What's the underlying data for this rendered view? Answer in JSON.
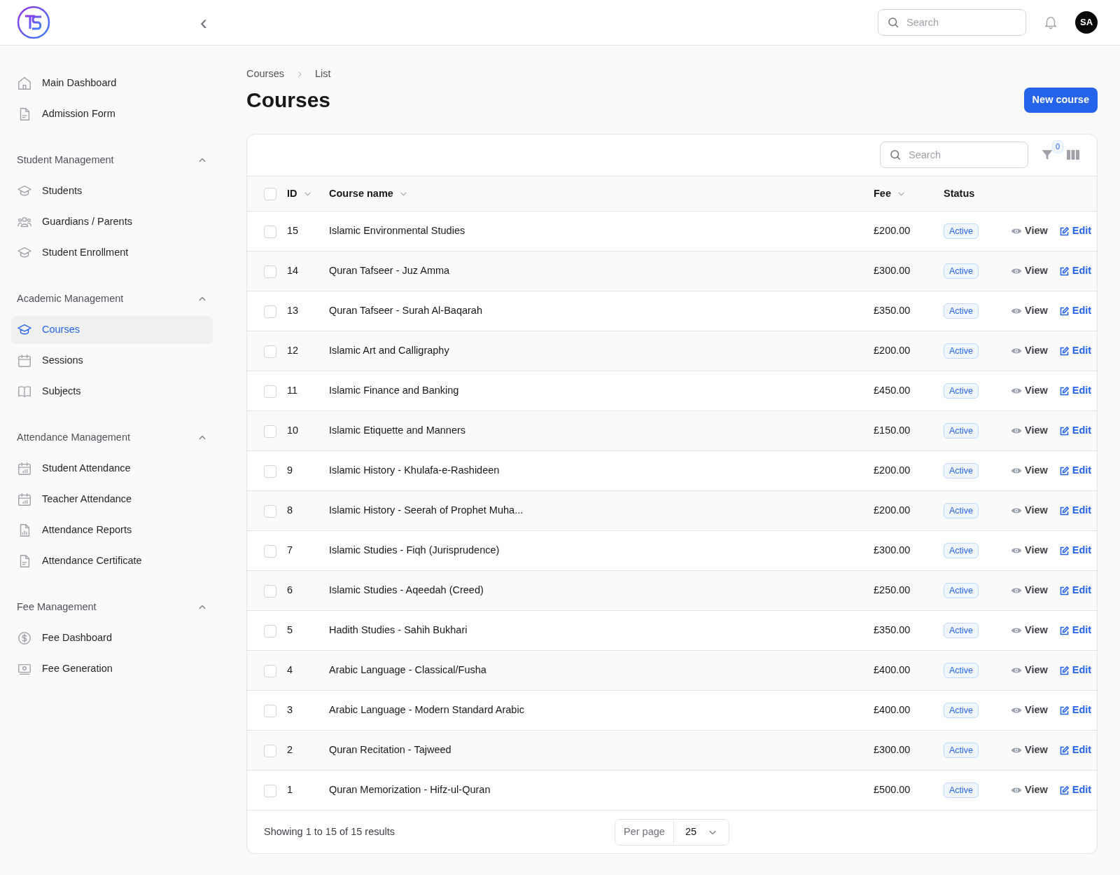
{
  "header": {
    "collapse_label": "‹",
    "search": {
      "placeholder": "Search"
    },
    "avatar": "SA"
  },
  "sidebar": {
    "items": [
      {
        "label": "Main Dashboard",
        "kind": "home",
        "selected": false
      },
      {
        "label": "Admission Form",
        "kind": "doc",
        "selected": false
      }
    ],
    "groups": [
      {
        "title": "Student Management",
        "expanded": true,
        "items": [
          {
            "label": "Students",
            "kind": "cap",
            "selected": false
          },
          {
            "label": "Guardians / Parents",
            "kind": "people",
            "selected": false
          },
          {
            "label": "Student Enrollment",
            "kind": "cap",
            "selected": false
          }
        ]
      },
      {
        "title": "Academic Management",
        "expanded": true,
        "items": [
          {
            "label": "Courses",
            "kind": "cap",
            "selected": true
          },
          {
            "label": "Sessions",
            "kind": "calendar",
            "selected": false
          },
          {
            "label": "Subjects",
            "kind": "book",
            "selected": false
          }
        ]
      },
      {
        "title": "Attendance Management",
        "expanded": true,
        "items": [
          {
            "label": "Student Attendance",
            "kind": "calchart",
            "selected": false
          },
          {
            "label": "Teacher Attendance",
            "kind": "calchart",
            "selected": false
          },
          {
            "label": "Attendance Reports",
            "kind": "docchart",
            "selected": false
          },
          {
            "label": "Attendance Certificate",
            "kind": "doc",
            "selected": false
          }
        ]
      },
      {
        "title": "Fee Management",
        "expanded": true,
        "items": [
          {
            "label": "Fee Dashboard",
            "kind": "dollar",
            "selected": false
          },
          {
            "label": "Fee Generation",
            "kind": "cash",
            "selected": false
          }
        ]
      }
    ]
  },
  "breadcrumb": [
    "Courses",
    "List"
  ],
  "title": "Courses",
  "new_button": "New course",
  "table": {
    "search": {
      "placeholder": "Search"
    },
    "filter_count": "0",
    "all_selected": false,
    "columns": [
      {
        "label": "ID",
        "sortable": true
      },
      {
        "label": "Course name",
        "sortable": true
      },
      {
        "label": "Fee",
        "sortable": true
      },
      {
        "label": "Status",
        "sortable": false
      }
    ],
    "rows": [
      {
        "id": "15",
        "name": "Islamic Environmental Studies",
        "fee": "£200.00",
        "status": "Active",
        "selected": false,
        "actions": [
          "View",
          "Edit"
        ]
      },
      {
        "id": "14",
        "name": "Quran Tafseer - Juz Amma",
        "fee": "£300.00",
        "status": "Active",
        "selected": false,
        "actions": [
          "View",
          "Edit"
        ]
      },
      {
        "id": "13",
        "name": "Quran Tafseer - Surah Al-Baqarah",
        "fee": "£350.00",
        "status": "Active",
        "selected": false,
        "actions": [
          "View",
          "Edit"
        ]
      },
      {
        "id": "12",
        "name": "Islamic Art and Calligraphy",
        "fee": "£200.00",
        "status": "Active",
        "selected": false,
        "actions": [
          "View",
          "Edit"
        ]
      },
      {
        "id": "11",
        "name": "Islamic Finance and Banking",
        "fee": "£450.00",
        "status": "Active",
        "selected": false,
        "actions": [
          "View",
          "Edit"
        ]
      },
      {
        "id": "10",
        "name": "Islamic Etiquette and Manners",
        "fee": "£150.00",
        "status": "Active",
        "selected": false,
        "actions": [
          "View",
          "Edit"
        ]
      },
      {
        "id": "9",
        "name": "Islamic History - Khulafa-e-Rashideen",
        "fee": "£200.00",
        "status": "Active",
        "selected": false,
        "actions": [
          "View",
          "Edit"
        ]
      },
      {
        "id": "8",
        "name": "Islamic History - Seerah of Prophet Muha...",
        "fee": "£200.00",
        "status": "Active",
        "selected": false,
        "actions": [
          "View",
          "Edit"
        ]
      },
      {
        "id": "7",
        "name": "Islamic Studies - Fiqh (Jurisprudence)",
        "fee": "£300.00",
        "status": "Active",
        "selected": false,
        "actions": [
          "View",
          "Edit"
        ]
      },
      {
        "id": "6",
        "name": "Islamic Studies - Aqeedah (Creed)",
        "fee": "£250.00",
        "status": "Active",
        "selected": false,
        "actions": [
          "View",
          "Edit"
        ]
      },
      {
        "id": "5",
        "name": "Hadith Studies - Sahih Bukhari",
        "fee": "£350.00",
        "status": "Active",
        "selected": false,
        "actions": [
          "View",
          "Edit"
        ]
      },
      {
        "id": "4",
        "name": "Arabic Language - Classical/Fusha",
        "fee": "£400.00",
        "status": "Active",
        "selected": false,
        "actions": [
          "View",
          "Edit"
        ]
      },
      {
        "id": "3",
        "name": "Arabic Language - Modern Standard Arabic",
        "fee": "£400.00",
        "status": "Active",
        "selected": false,
        "actions": [
          "View",
          "Edit"
        ]
      },
      {
        "id": "2",
        "name": "Quran Recitation - Tajweed",
        "fee": "£300.00",
        "status": "Active",
        "selected": false,
        "actions": [
          "View",
          "Edit"
        ]
      },
      {
        "id": "1",
        "name": "Quran Memorization - Hifz-ul-Quran",
        "fee": "£500.00",
        "status": "Active",
        "selected": false,
        "actions": [
          "View",
          "Edit"
        ]
      }
    ],
    "footer": {
      "summary": "Showing 1 to 15 of 15 results",
      "per_page_label": "Per page",
      "per_page": "25"
    }
  }
}
